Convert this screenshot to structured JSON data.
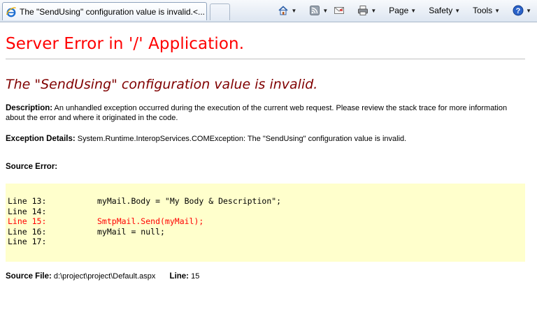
{
  "browser": {
    "tab_title": "The \"SendUsing\" configuration value is invalid.<...",
    "commands": {
      "page": "Page",
      "safety": "Safety",
      "tools": "Tools"
    }
  },
  "error": {
    "heading": "Server Error in '/' Application.",
    "title": "The \"SendUsing\" configuration value is invalid.",
    "description_label": "Description:",
    "description_text": "An unhandled exception occurred during the execution of the current web request. Please review the stack trace for more information about the error and where it originated in the code.",
    "exception_label": "Exception Details:",
    "exception_text": "System.Runtime.InteropServices.COMException: The \"SendUsing\" configuration value is invalid.",
    "source_error_label": "Source Error:",
    "source_lines": [
      {
        "num": "Line 13:",
        "code": "myMail.Body = \"My Body & Description\";",
        "error": false
      },
      {
        "num": "Line 14:",
        "code": "",
        "error": false
      },
      {
        "num": "Line 15:",
        "code": "SmtpMail.Send(myMail);",
        "error": true
      },
      {
        "num": "Line 16:",
        "code": "myMail = null;",
        "error": false
      },
      {
        "num": "Line 17:",
        "code": "",
        "error": false
      }
    ],
    "source_file_label": "Source File:",
    "source_file_value": "d:\\project\\project\\Default.aspx",
    "line_label": "Line:",
    "line_value": "15"
  },
  "colors": {
    "heading": "#ff0000",
    "title": "#800000",
    "code_background": "#ffffcc",
    "error_line": "#ff0000"
  }
}
